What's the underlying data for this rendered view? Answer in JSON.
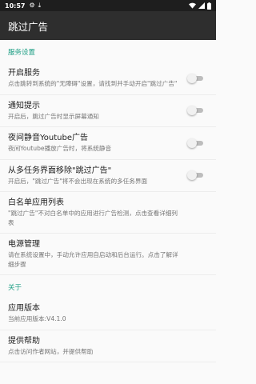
{
  "status_bar": {
    "time": "10:57",
    "icons": [
      "gear-icon",
      "download-icon",
      "wifi-icon",
      "signal-icon",
      "battery-icon"
    ]
  },
  "toolbar": {
    "title": "跳过广告"
  },
  "sections": [
    {
      "header": "服务设置",
      "items": [
        {
          "title": "开启服务",
          "summary": "点击跳转到系统的\"无障碍\"设置，请找到并手动开启\"跳过广告\"",
          "switch": false
        },
        {
          "title": "通知提示",
          "summary": "开启后，跳过广告时显示屏幕通知",
          "switch": false
        },
        {
          "title": "夜间静音Youtube广告",
          "summary": "夜间Youtube播放广告时，将系统静音",
          "switch": false
        },
        {
          "title": "从多任务界面移除\"跳过广告\"",
          "summary": "开启后，\"跳过广告\"将不会出现在系统的多任务界面",
          "switch": false
        },
        {
          "title": "白名单应用列表",
          "summary": "\"跳过广告\"不对白名单中的应用进行广告检测，点击查看详细列表"
        },
        {
          "title": "电源管理",
          "summary": "请在系统设置中，手动允许应用自启动和后台运行。点击了解详细步骤"
        }
      ]
    },
    {
      "header": "关于",
      "items": [
        {
          "title": "应用版本",
          "summary": "当前应用版本:V4.1.0"
        },
        {
          "title": "提供帮助",
          "summary": "点击访问作者网站，并提供帮助"
        }
      ]
    }
  ],
  "colors": {
    "accent": "#1f9f85",
    "toolbar": "#2e2e2e",
    "status_bar": "#1e1e1e"
  }
}
